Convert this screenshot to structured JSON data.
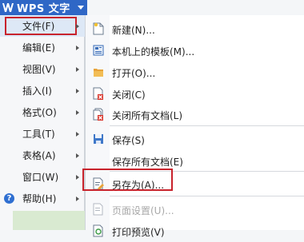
{
  "app": {
    "title": "WPS 文字"
  },
  "main_menu": {
    "items": [
      {
        "label": "文件(F)"
      },
      {
        "label": "编辑(E)"
      },
      {
        "label": "视图(V)"
      },
      {
        "label": "插入(I)"
      },
      {
        "label": "格式(O)"
      },
      {
        "label": "工具(T)"
      },
      {
        "label": "表格(A)"
      },
      {
        "label": "窗口(W)"
      },
      {
        "label": "帮助(H)"
      }
    ]
  },
  "file_menu": {
    "items": [
      {
        "label": "新建(N)...",
        "icon": "new-document-icon"
      },
      {
        "label": "本机上的模板(M)...",
        "icon": "template-icon"
      },
      {
        "label": "打开(O)...",
        "icon": "open-folder-icon"
      },
      {
        "label": "关闭(C)",
        "icon": "close-document-icon"
      },
      {
        "label": "关闭所有文档(L)",
        "icon": "close-all-icon"
      },
      {
        "label": "保存(S)",
        "icon": "save-icon"
      },
      {
        "label": "保存所有文档(E)",
        "icon": ""
      },
      {
        "label": "另存为(A)...",
        "icon": "save-as-icon"
      },
      {
        "label": "页面设置(U)...",
        "icon": "page-setup-icon"
      },
      {
        "label": "打印预览(V)",
        "icon": "print-preview-icon"
      }
    ]
  },
  "colors": {
    "title_bar": "#2f67c6",
    "highlight_border": "#c8232c",
    "hover": "#dde8f6"
  }
}
